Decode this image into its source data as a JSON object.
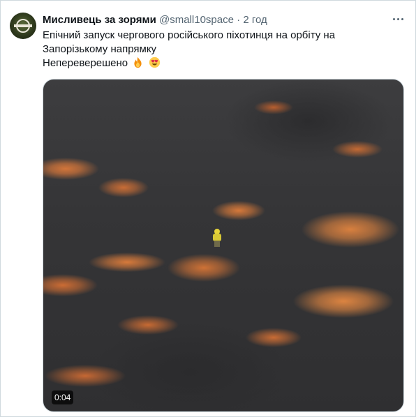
{
  "tweet": {
    "author_name": "Мисливець за зорями",
    "author_handle": "@small10space",
    "separator": "·",
    "time": "2 год",
    "text_line_1": "Епічний запуск чергового російського піхотинця на орбіту на",
    "text_line_2": "Запорізькому напрямку",
    "text_line_3": "Непереверешено",
    "emojis": [
      "fire-emoji",
      "heart-eyes-emoji"
    ],
    "avatar_icon": "profile-avatar-emblem",
    "more_icon": "more-options-icon"
  },
  "media": {
    "type": "video",
    "duration": "0:04"
  }
}
